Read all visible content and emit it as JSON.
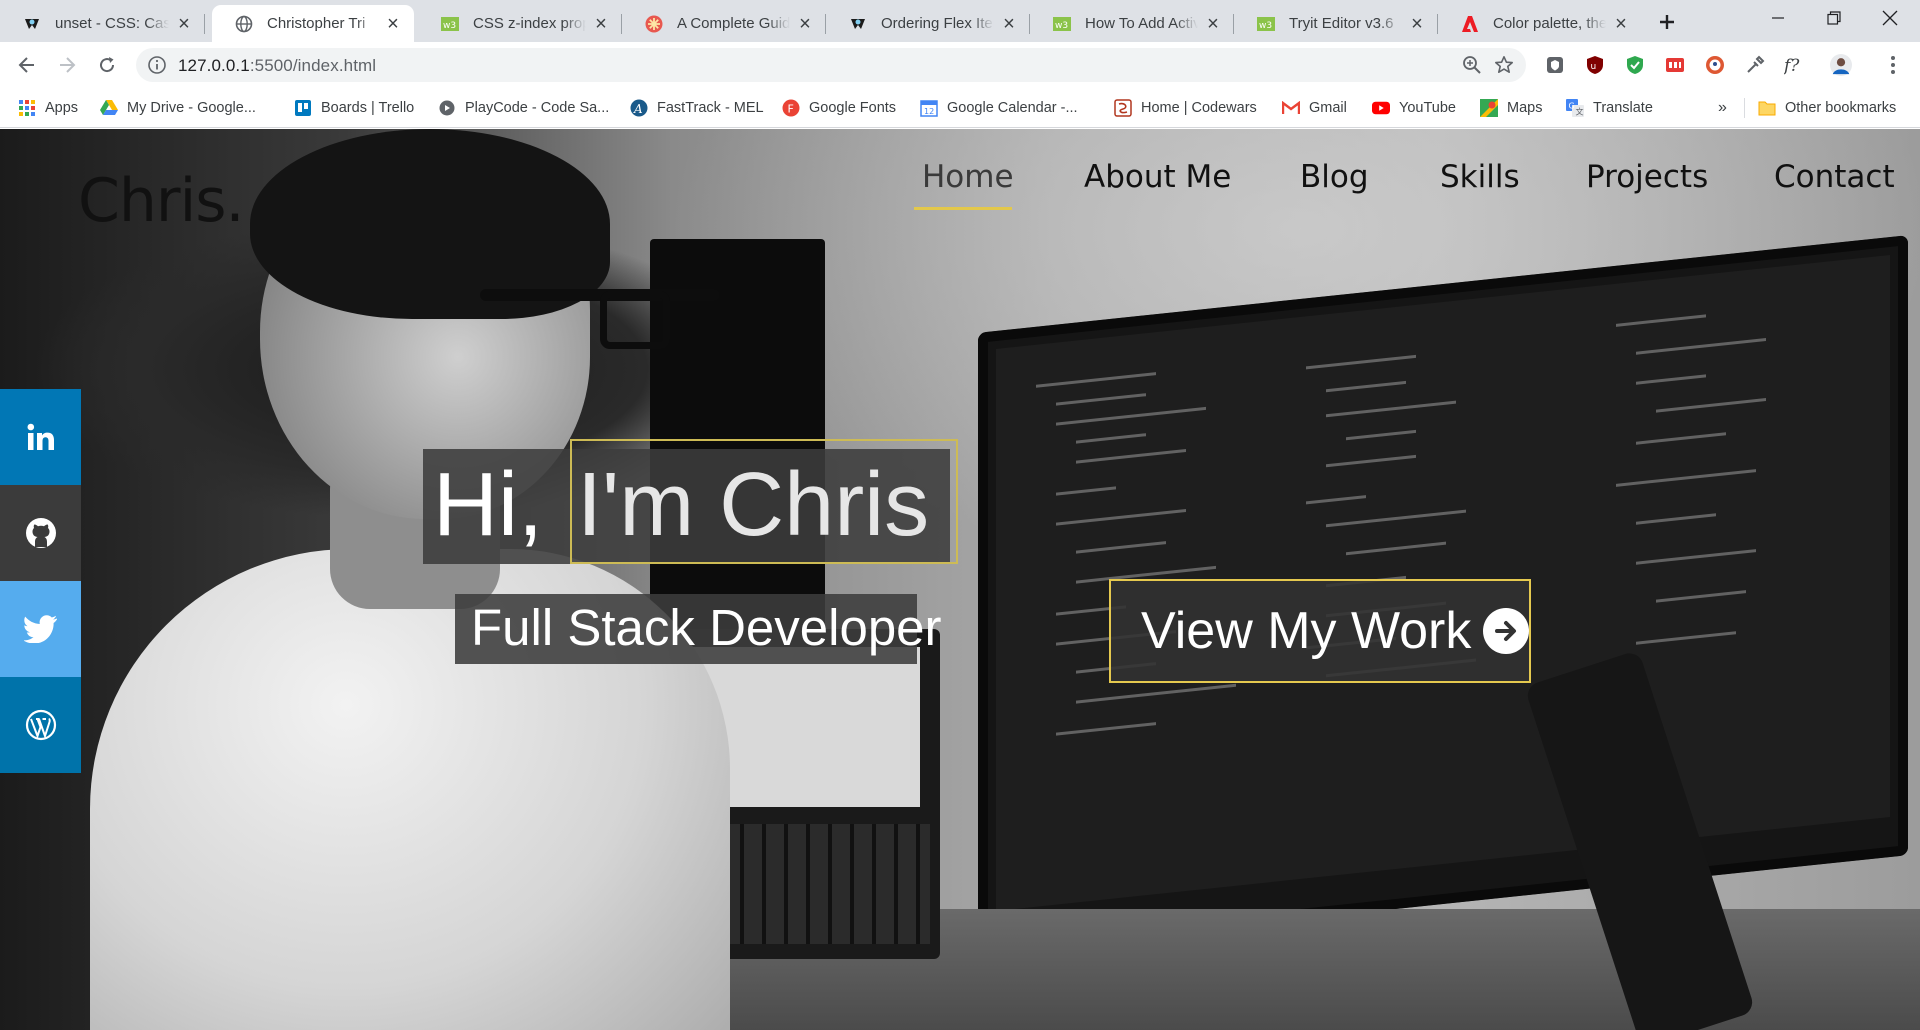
{
  "browser": {
    "tabs": [
      {
        "title": "unset - CSS: Cascading",
        "icon": "mdn-icon"
      },
      {
        "title": "Christopher Tri",
        "icon": "globe-icon",
        "active": true
      },
      {
        "title": "CSS z-index property",
        "icon": "w3schools-icon"
      },
      {
        "title": "A Complete Guide",
        "icon": "csstricks-icon"
      },
      {
        "title": "Ordering Flex Items",
        "icon": "mdn-icon"
      },
      {
        "title": "How To Add Active",
        "icon": "w3schools-icon"
      },
      {
        "title": "Tryit Editor v3.6",
        "icon": "w3schools-icon"
      },
      {
        "title": "Color palette, the c",
        "icon": "adobe-icon"
      }
    ],
    "address": {
      "host": "127.0.0.1",
      "path": ":5500/index.html"
    },
    "bookmarks": [
      {
        "label": "Apps",
        "icon": "apps-grid-icon"
      },
      {
        "label": "My Drive - Google...",
        "icon": "google-drive-icon"
      },
      {
        "label": "Boards | Trello",
        "icon": "trello-icon"
      },
      {
        "label": "PlayCode - Code Sa...",
        "icon": "playcode-icon"
      },
      {
        "label": "FastTrack - MEL",
        "icon": "fasttrack-icon"
      },
      {
        "label": "Google Fonts",
        "icon": "google-fonts-icon"
      },
      {
        "label": "Google Calendar -...",
        "icon": "google-calendar-icon"
      },
      {
        "label": "Home | Codewars",
        "icon": "codewars-icon"
      },
      {
        "label": "Gmail",
        "icon": "gmail-icon"
      },
      {
        "label": "YouTube",
        "icon": "youtube-icon"
      },
      {
        "label": "Maps",
        "icon": "maps-icon"
      },
      {
        "label": "Translate",
        "icon": "translate-icon"
      }
    ],
    "bookmarks_overflow": "»",
    "other_bookmarks": "Other bookmarks"
  },
  "site": {
    "logo": "Chris.",
    "nav": [
      "Home",
      "About Me",
      "Blog",
      "Skills",
      "Projects",
      "Contact"
    ],
    "active_nav": "Home",
    "hero": {
      "greeting": "Hi,",
      "name": "I'm Chris",
      "subtitle": "Full Stack Developer",
      "cta": "View My Work"
    },
    "social": [
      {
        "name": "linkedin",
        "color": "#0177b5"
      },
      {
        "name": "github",
        "color": "#3b3b3b"
      },
      {
        "name": "twitter",
        "color": "#55acee"
      },
      {
        "name": "wordpress",
        "color": "#0073aa"
      }
    ],
    "accent": "#e5c94f"
  }
}
